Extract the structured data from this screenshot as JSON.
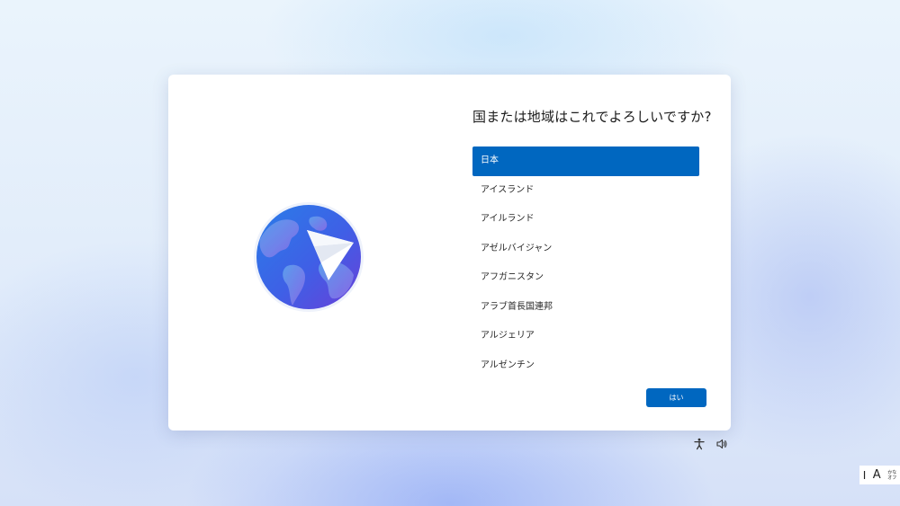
{
  "dialog": {
    "title": "国または地域はこれでよろしいですか?",
    "countries": [
      {
        "label": "日本",
        "selected": true
      },
      {
        "label": "アイスランド",
        "selected": false
      },
      {
        "label": "アイルランド",
        "selected": false
      },
      {
        "label": "アゼルバイジャン",
        "selected": false
      },
      {
        "label": "アフガニスタン",
        "selected": false
      },
      {
        "label": "アラブ首長国連邦",
        "selected": false
      },
      {
        "label": "アルジェリア",
        "selected": false
      },
      {
        "label": "アルゼンチン",
        "selected": false
      }
    ],
    "yes_label": "はい"
  },
  "illustration": {
    "icon": "globe-with-paper-plane-icon"
  },
  "tray": {
    "accessibility_icon": "accessibility-icon",
    "volume_icon": "volume-icon"
  },
  "ime": {
    "cursor_glyph": "I",
    "mode_glyph": "A",
    "kana_top": "かな",
    "kana_bottom": "オフ"
  },
  "colors": {
    "accent": "#0067c0",
    "dialog_bg": "#ffffff",
    "text": "#1b1b1b"
  }
}
